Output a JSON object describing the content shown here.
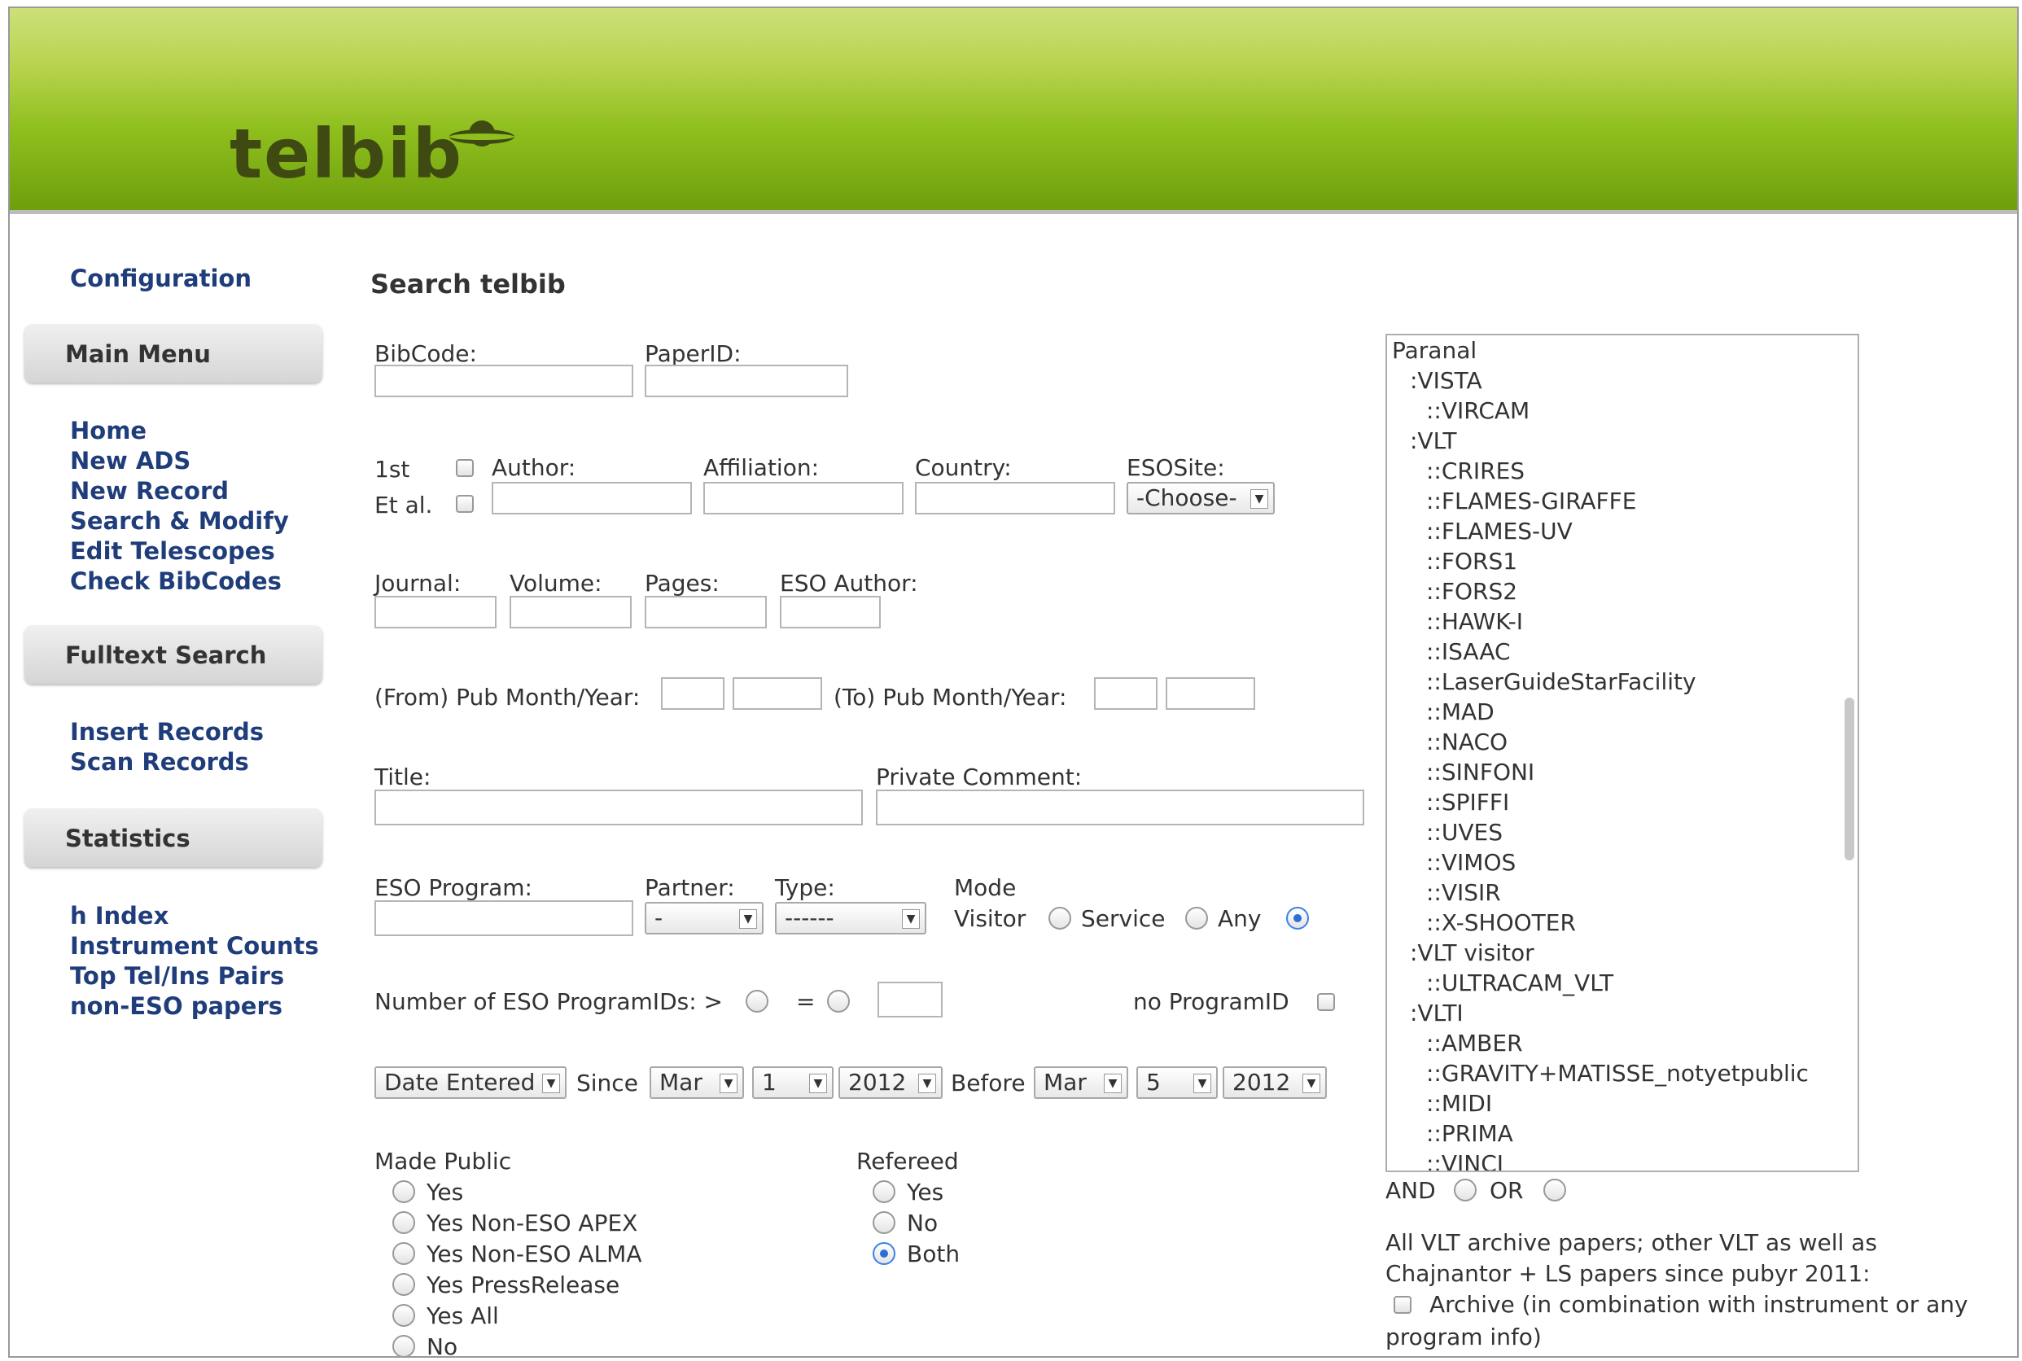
{
  "brand": {
    "logo_text": "telbib"
  },
  "sidebar": {
    "config_link": "Configuration",
    "main_menu_label": "Main Menu",
    "main_links": [
      "Home",
      "New ADS",
      "New Record",
      "Search & Modify",
      "Edit Telescopes",
      "Check BibCodes"
    ],
    "fulltext_label": "Fulltext Search",
    "fulltext_links": [
      "Insert Records",
      "Scan Records"
    ],
    "stats_label": "Statistics",
    "stats_links": [
      "h Index",
      "Instrument Counts",
      "Top Tel/Ins Pairs",
      "non-ESO papers"
    ]
  },
  "form": {
    "title": "Search telbib",
    "bibcode_label": "BibCode:",
    "paperid_label": "PaperID:",
    "first_label": "1st",
    "etal_label": "Et al.",
    "author_label": "Author:",
    "affiliation_label": "Affiliation:",
    "country_label": "Country:",
    "esosite_label": "ESOSite:",
    "esosite_value": "-Choose-",
    "journal_label": "Journal:",
    "volume_label": "Volume:",
    "pages_label": "Pages:",
    "esoauthor_label": "ESO Author:",
    "from_pub_label": "(From) Pub Month/Year:",
    "to_pub_label": "(To) Pub Month/Year:",
    "title_label": "Title:",
    "private_comment_label": "Private Comment:",
    "eso_program_label": "ESO Program:",
    "partner_label": "Partner:",
    "partner_value": "-",
    "type_label": "Type:",
    "type_value": "------",
    "mode_label": "Mode",
    "mode_visitor": "Visitor",
    "mode_service": "Service",
    "mode_any": "Any",
    "num_progids_label": "Number of ESO ProgramIDs: >",
    "equals_label": "=",
    "no_progid_label": "no ProgramID",
    "date_field_value": "Date Entered",
    "since_label": "Since",
    "since_month": "Mar",
    "since_day": "1",
    "since_year": "2012",
    "before_label": "Before",
    "before_month": "Mar",
    "before_day": "5",
    "before_year": "2012",
    "made_public_label": "Made Public",
    "made_public_options": [
      "Yes",
      "Yes Non-ESO APEX",
      "Yes Non-ESO ALMA",
      "Yes PressRelease",
      "Yes All",
      "No"
    ],
    "refereed_label": "Refereed",
    "refereed_options": [
      "Yes",
      "No",
      "Both"
    ],
    "refereed_selected": "Both",
    "mode_selected": "Any"
  },
  "instrument_tree": {
    "items": [
      "Paranal",
      ":VISTA",
      "::VIRCAM",
      ":VLT",
      "::CRIRES",
      "::FLAMES-GIRAFFE",
      "::FLAMES-UV",
      "::FORS1",
      "::FORS2",
      "::HAWK-I",
      "::ISAAC",
      "::LaserGuideStarFacility",
      "::MAD",
      "::NACO",
      "::SINFONI",
      "::SPIFFI",
      "::UVES",
      "::VIMOS",
      "::VISIR",
      "::X-SHOOTER",
      ":VLT visitor",
      "::ULTRACAM_VLT",
      ":VLTI",
      "::AMBER",
      "::GRAVITY+MATISSE_notyetpublic",
      "::MIDI",
      "::PRIMA",
      "::VINCI"
    ],
    "and_label": "AND",
    "or_label": "OR"
  },
  "archive_note": {
    "line1": "All VLT archive papers; other VLT as well as",
    "line2": "Chajnantor + LS papers since pubyr 2011:",
    "archive_label": "Archive (in combination with instrument or any",
    "archive_label2": "program info)"
  },
  "colors": {
    "link": "#1f3d7a",
    "header_green": "#8fbf1e",
    "logo": "#3e4a12",
    "radio_selected": "#2a6fd6"
  }
}
